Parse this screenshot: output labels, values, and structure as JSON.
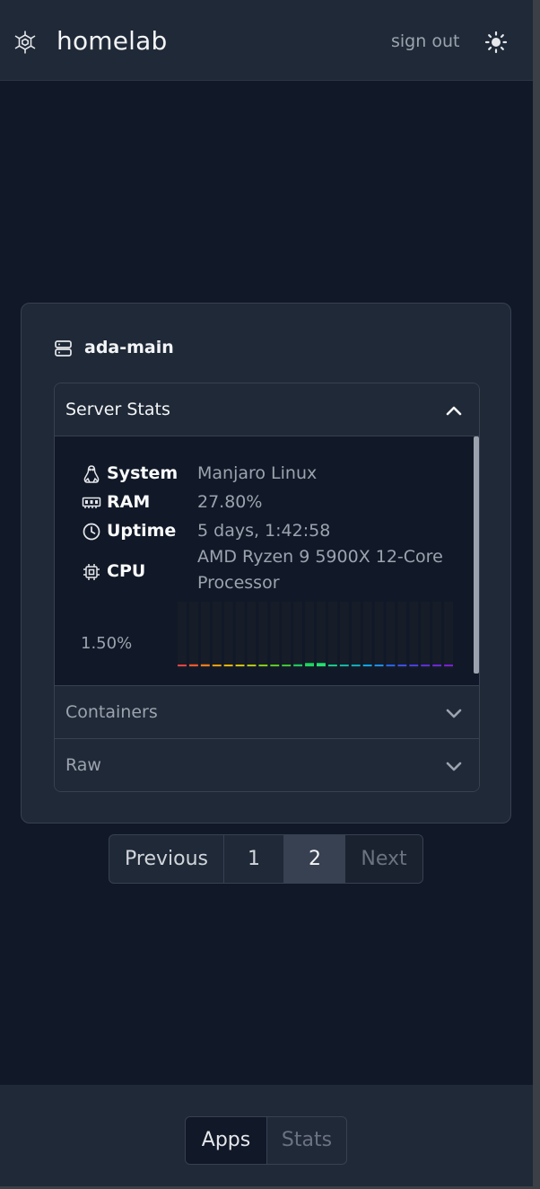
{
  "header": {
    "logo_icon": "hexagon-network-logo-icon",
    "title": "homelab",
    "sign_out_label": "sign out",
    "theme_icon": "sun-icon"
  },
  "server": {
    "icon": "server-icon",
    "name": "ada-main",
    "sections": [
      {
        "label": "Server Stats",
        "expanded": true
      },
      {
        "label": "Containers",
        "expanded": false
      },
      {
        "label": "Raw",
        "expanded": false
      }
    ],
    "stats": {
      "system_label": "System",
      "system_value": "Manjaro Linux",
      "ram_label": "RAM",
      "ram_value": "27.80%",
      "uptime_label": "Uptime",
      "uptime_value": "5 days, 1:42:58",
      "cpu_label": "CPU",
      "cpu_value": "AMD Ryzen 9 5900X 12-Core Processor",
      "cpu_usage": "1.50%"
    },
    "cpu_cores": [
      {
        "level": 0.02,
        "color": "#ef4444"
      },
      {
        "level": 0.03,
        "color": "#f15a2e"
      },
      {
        "level": 0.03,
        "color": "#f47c20"
      },
      {
        "level": 0.02,
        "color": "#f59e0b"
      },
      {
        "level": 0.02,
        "color": "#eab308"
      },
      {
        "level": 0.02,
        "color": "#d4c010"
      },
      {
        "level": 0.02,
        "color": "#b5c417"
      },
      {
        "level": 0.0,
        "color": "#84cc16"
      },
      {
        "level": 0.02,
        "color": "#5fc724"
      },
      {
        "level": 0.02,
        "color": "#3fc535"
      },
      {
        "level": 0.03,
        "color": "#22c55e"
      },
      {
        "level": 0.05,
        "color": "#1ed45e"
      },
      {
        "level": 0.05,
        "color": "#24e070"
      },
      {
        "level": 0.02,
        "color": "#18c98a"
      },
      {
        "level": 0.02,
        "color": "#14b8a6"
      },
      {
        "level": 0.02,
        "color": "#12aabd"
      },
      {
        "level": 0.02,
        "color": "#0ea5e9"
      },
      {
        "level": 0.02,
        "color": "#1d8ff0"
      },
      {
        "level": 0.02,
        "color": "#2563eb"
      },
      {
        "level": 0.02,
        "color": "#3b4fe6"
      },
      {
        "level": 0.02,
        "color": "#4a3fe0"
      },
      {
        "level": 0.02,
        "color": "#5b2fd8"
      },
      {
        "level": 0.02,
        "color": "#6d28d9"
      },
      {
        "level": 0.02,
        "color": "#7c1fd4"
      }
    ]
  },
  "pagination": {
    "previous_label": "Previous",
    "page_1": "1",
    "page_2": "2",
    "next_label": "Next",
    "current_page": 2
  },
  "footer": {
    "apps_label": "Apps",
    "stats_label": "Stats",
    "active": "Apps"
  }
}
